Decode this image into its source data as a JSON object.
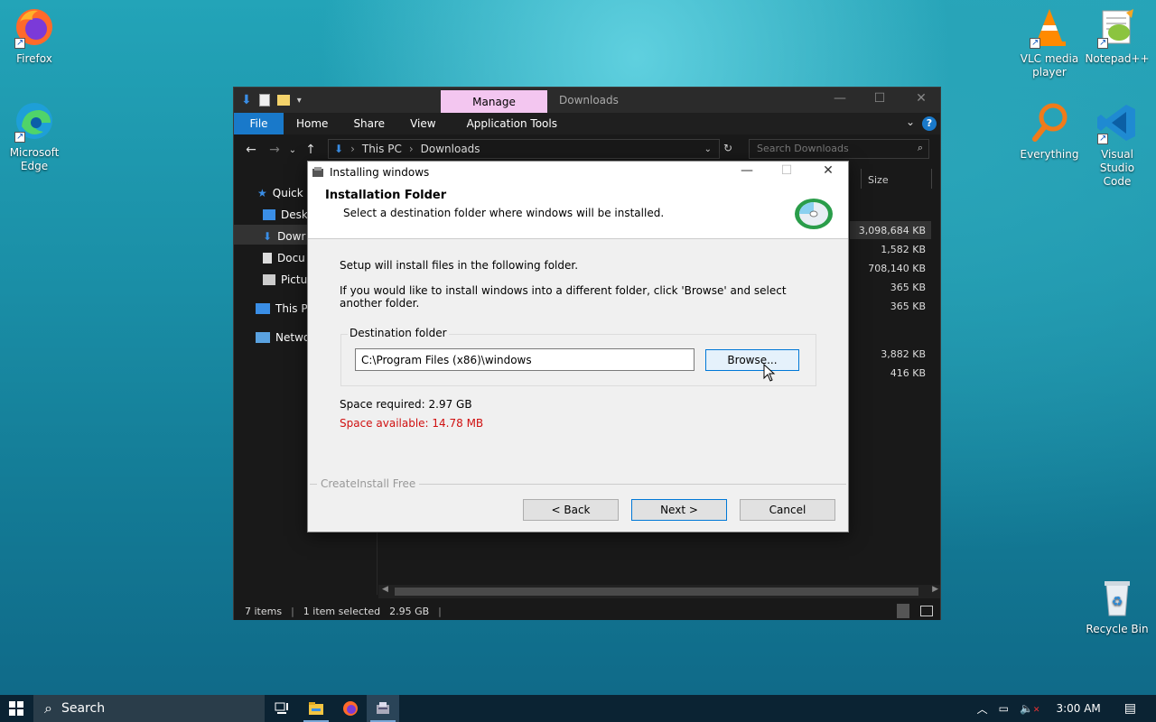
{
  "desktop": {
    "icons": [
      {
        "label": "Firefox"
      },
      {
        "label": "Microsoft Edge"
      },
      {
        "label": "VLC media player"
      },
      {
        "label": "Notepad++"
      },
      {
        "label": "Everything"
      },
      {
        "label": "Visual Studio Code"
      },
      {
        "label": "Recycle Bin"
      }
    ]
  },
  "explorer": {
    "title": "Downloads",
    "context_tab": "Manage",
    "ribbon_tabs": [
      "File",
      "Home",
      "Share",
      "View",
      "Application Tools"
    ],
    "address": {
      "segments": [
        "This PC",
        "Downloads"
      ]
    },
    "search_placeholder": "Search Downloads",
    "nav_items": [
      "Quick a",
      "Deskt",
      "Dowr",
      "Docu",
      "Pictur",
      "This PC",
      "Netwo"
    ],
    "column_size_header": "Size",
    "sizes": [
      "3,098,684 KB",
      "1,582 KB",
      "708,140 KB",
      "365 KB",
      "365 KB",
      "3,882 KB",
      "416 KB"
    ],
    "status": {
      "items": "7 items",
      "selected": "1 item selected",
      "selected_size": "2.95 GB"
    }
  },
  "installer": {
    "window_title": "Installing windows",
    "header_title": "Installation Folder",
    "header_subtitle": "Select a destination folder where windows will be installed.",
    "line1": "Setup will install files in the following folder.",
    "line2": "If you would like to install windows into a different folder, click 'Browse' and select another folder.",
    "dest_label": "Destination folder",
    "dest_path": "C:\\Program Files (x86)\\windows",
    "browse_label": "Browse...",
    "space_required": "Space required: 2.97 GB",
    "space_available": "Space available: 14.78 MB",
    "brand": "CreateInstall Free",
    "back_label": "< Back",
    "next_label": "Next >",
    "cancel_label": "Cancel",
    "error_color": "#d01010"
  },
  "taskbar": {
    "search_label": "Search",
    "clock": "3:00 AM"
  }
}
